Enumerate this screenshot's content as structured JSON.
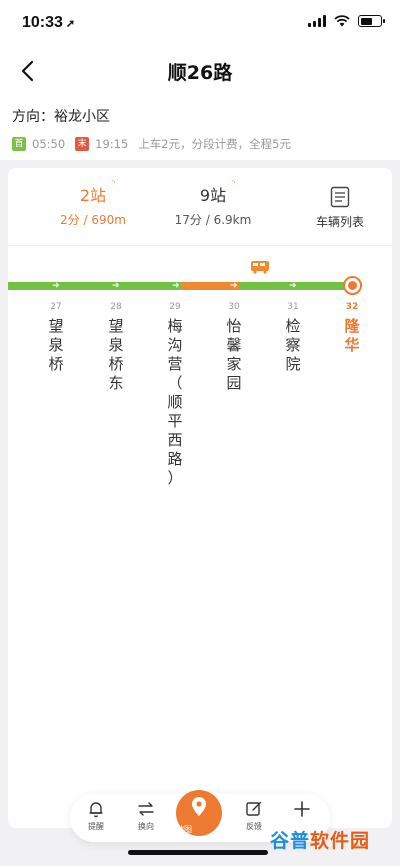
{
  "status": {
    "time": "10:33",
    "location_arrow": "➚"
  },
  "nav": {
    "title": "顺26路",
    "back_icon": "chevron-left"
  },
  "route": {
    "direction": "方向：裕龙小区",
    "first_badge": "首",
    "first_time": "05:50",
    "last_badge": "末",
    "last_time": "19:15",
    "fare": "上车2元，分段计费，全程5元"
  },
  "stats": {
    "stops_away": "2站",
    "eta": "2分 / 690m",
    "next_stops": "9站",
    "next_eta": "17分 / 6.9km",
    "vehicle_list": "车辆列表"
  },
  "stations": [
    {
      "num": "27",
      "name": "望泉桥"
    },
    {
      "num": "28",
      "name": "望泉桥东"
    },
    {
      "num": "29",
      "name": "梅沟营（顺平西路）"
    },
    {
      "num": "30",
      "name": "怡馨家园"
    },
    {
      "num": "31",
      "name": "检察院"
    },
    {
      "num": "32",
      "name": "隆华"
    }
  ],
  "tabs": {
    "remind": "提醒",
    "switch": "换向",
    "map": "地图",
    "feedback": "反馈"
  },
  "watermark": {
    "part1": "谷普",
    "part2": "软件园"
  },
  "colors": {
    "accent": "#ee7a32",
    "line_green": "#74c043",
    "line_orange": "#f0892f",
    "first_badge": "#7dbf4a",
    "last_badge": "#e4583e"
  }
}
